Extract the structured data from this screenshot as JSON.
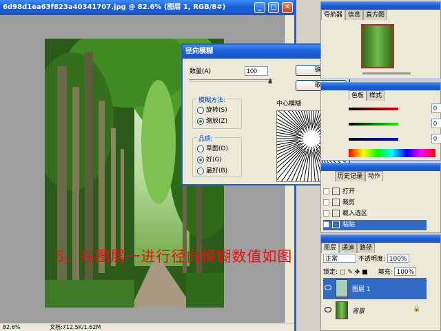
{
  "document": {
    "title": "6d98d1ea63f823a40341707.jpg @ 82.6% (图层 1, RGB/8#)",
    "status": "文档:712.5K/1.62M"
  },
  "dialog": {
    "title": "径向模糊",
    "amount_label": "数量(A)",
    "amount_value": "100",
    "ok_label": "确定",
    "cancel_label": "取消",
    "method_group": "模糊方法:",
    "method_spin": "旋转(S)",
    "method_zoom": "缩放(Z)",
    "quality_group": "品质:",
    "quality_draft": "草图(D)",
    "quality_good": "好(G)",
    "quality_best": "最好(B)",
    "center_label": "中心模糊"
  },
  "navigator": {
    "tabs": [
      "导航器",
      "信息",
      "直方图"
    ]
  },
  "color_panel": {
    "tabs": [
      "色板",
      "样式"
    ],
    "r_value": "0",
    "g_value": "0",
    "b_value": "0"
  },
  "history_panel": {
    "tabs": [
      "历史记录",
      "动作"
    ],
    "items": [
      "打开",
      "裁剪",
      "载入选区",
      "粘贴"
    ]
  },
  "layers_panel": {
    "tabs": [
      "图层",
      "通道",
      "路径"
    ],
    "mode": "正常",
    "opacity_label": "不透明度:",
    "opacity_value": "100%",
    "lock_label": "锁定:",
    "fill_label": "填充:",
    "fill_value": "100%",
    "layers": [
      "图层 1",
      "背景"
    ]
  },
  "caption": "5、在图层一进行径向模糊数值如图"
}
